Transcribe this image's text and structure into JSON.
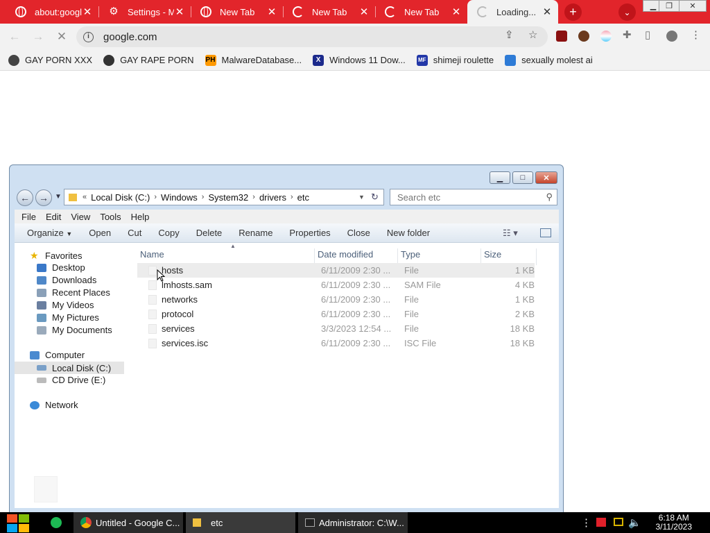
{
  "browser": {
    "tabs": [
      {
        "title": "about:google",
        "icon": "globe-icon",
        "active": false
      },
      {
        "title": "Settings - M",
        "icon": "gear-icon",
        "active": false
      },
      {
        "title": "New Tab",
        "icon": "globe-icon",
        "active": false
      },
      {
        "title": "New Tab",
        "icon": "loading-icon",
        "active": false
      },
      {
        "title": "New Tab",
        "icon": "loading-icon",
        "active": false
      },
      {
        "title": "Loading...",
        "icon": "loading-icon",
        "active": true
      }
    ],
    "new_tab_label": "+",
    "address": "google.com",
    "accent_color": "#e2252b"
  },
  "bookmarks": [
    {
      "label": "GAY PORN XXX",
      "icon": "person-icon"
    },
    {
      "label": "GAY RAPE PORN",
      "icon": "globe-icon"
    },
    {
      "label": "MalwareDatabase...",
      "icon": "ph-icon",
      "icon_text": "PH"
    },
    {
      "label": "Windows 11 Dow...",
      "icon": "x-icon",
      "icon_text": "X"
    },
    {
      "label": "shimeji roulette",
      "icon": "mft-icon",
      "icon_text": "MF"
    },
    {
      "label": "sexually molest ai",
      "icon": "app-icon"
    }
  ],
  "explorer": {
    "breadcrumb": [
      "Local Disk (C:)",
      "Windows",
      "System32",
      "drivers",
      "etc"
    ],
    "search_placeholder": "Search etc",
    "menu": [
      "File",
      "Edit",
      "View",
      "Tools",
      "Help"
    ],
    "commands": [
      "Organize",
      "Open",
      "Cut",
      "Copy",
      "Delete",
      "Rename",
      "Properties",
      "Close",
      "New folder"
    ],
    "nav": {
      "favorites_label": "Favorites",
      "favorites": [
        "Desktop",
        "Downloads",
        "Recent Places",
        "My Videos",
        "My Pictures",
        "My Documents"
      ],
      "computer_label": "Computer",
      "computer": [
        "Local Disk (C:)",
        "CD Drive (E:)"
      ],
      "network_label": "Network"
    },
    "columns": [
      "Name",
      "Date modified",
      "Type",
      "Size"
    ],
    "files": [
      {
        "name": "hosts",
        "date": "6/11/2009 2:30 ...",
        "type": "File",
        "size": "1 KB"
      },
      {
        "name": "lmhosts.sam",
        "date": "6/11/2009 2:30 ...",
        "type": "SAM File",
        "size": "4 KB"
      },
      {
        "name": "networks",
        "date": "6/11/2009 2:30 ...",
        "type": "File",
        "size": "1 KB"
      },
      {
        "name": "protocol",
        "date": "6/11/2009 2:30 ...",
        "type": "File",
        "size": "2 KB"
      },
      {
        "name": "services",
        "date": "3/3/2023 12:54 ...",
        "type": "File",
        "size": "18 KB"
      },
      {
        "name": "services.isc",
        "date": "6/11/2009 2:30 ...",
        "type": "ISC File",
        "size": "18 KB"
      }
    ]
  },
  "taskbar": {
    "items": [
      "Untitled - Google C...",
      "etc",
      "Administrator: C:\\W..."
    ],
    "time": "6:18 AM",
    "date": "3/11/2023"
  }
}
